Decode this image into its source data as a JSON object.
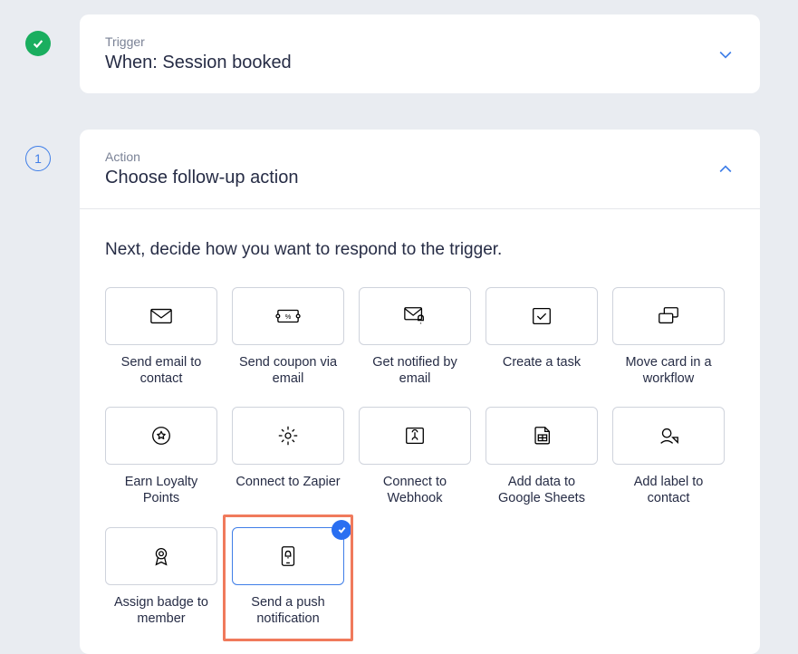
{
  "trigger": {
    "eyebrow": "Trigger",
    "title": "When: Session booked",
    "indicator_number": "",
    "expanded": false
  },
  "action": {
    "eyebrow": "Action",
    "title": "Choose follow-up action",
    "indicator_number": "1",
    "expanded": true,
    "prompt": "Next, decide how you want to respond to the trigger.",
    "options": [
      {
        "id": "send-email",
        "label": "Send email to contact",
        "icon": "envelope"
      },
      {
        "id": "send-coupon",
        "label": "Send coupon via email",
        "icon": "coupon"
      },
      {
        "id": "notify-email",
        "label": "Get notified by email",
        "icon": "envelope-bell"
      },
      {
        "id": "create-task",
        "label": "Create a task",
        "icon": "task"
      },
      {
        "id": "move-card",
        "label": "Move card in a workflow",
        "icon": "cards"
      },
      {
        "id": "earn-points",
        "label": "Earn Loyalty Points",
        "icon": "star-circle"
      },
      {
        "id": "zapier",
        "label": "Connect to Zapier",
        "icon": "gear"
      },
      {
        "id": "webhook",
        "label": "Connect to Webhook",
        "icon": "webhook"
      },
      {
        "id": "google-sheets",
        "label": "Add data to Google Sheets",
        "icon": "sheets"
      },
      {
        "id": "add-label",
        "label": "Add label to contact",
        "icon": "label-contact"
      },
      {
        "id": "assign-badge",
        "label": "Assign badge to member",
        "icon": "badge"
      },
      {
        "id": "push-notification",
        "label": "Send a push notification",
        "icon": "phone-bell",
        "selected": true,
        "highlighted": true
      }
    ]
  },
  "colors": {
    "accent": "#3f7ee8",
    "success": "#1aae5f",
    "highlight": "#f07a5c",
    "panel": "#ffffff",
    "background": "#e9ecf1"
  }
}
